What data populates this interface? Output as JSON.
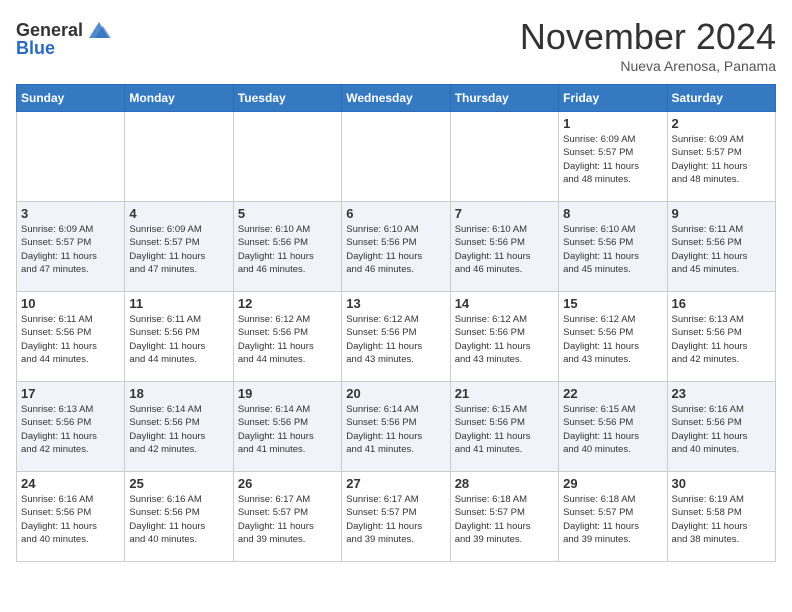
{
  "header": {
    "logo_general": "General",
    "logo_blue": "Blue",
    "month_title": "November 2024",
    "location": "Nueva Arenosa, Panama"
  },
  "weekdays": [
    "Sunday",
    "Monday",
    "Tuesday",
    "Wednesday",
    "Thursday",
    "Friday",
    "Saturday"
  ],
  "weeks": [
    [
      {
        "day": "",
        "info": ""
      },
      {
        "day": "",
        "info": ""
      },
      {
        "day": "",
        "info": ""
      },
      {
        "day": "",
        "info": ""
      },
      {
        "day": "",
        "info": ""
      },
      {
        "day": "1",
        "info": "Sunrise: 6:09 AM\nSunset: 5:57 PM\nDaylight: 11 hours\nand 48 minutes."
      },
      {
        "day": "2",
        "info": "Sunrise: 6:09 AM\nSunset: 5:57 PM\nDaylight: 11 hours\nand 48 minutes."
      }
    ],
    [
      {
        "day": "3",
        "info": "Sunrise: 6:09 AM\nSunset: 5:57 PM\nDaylight: 11 hours\nand 47 minutes."
      },
      {
        "day": "4",
        "info": "Sunrise: 6:09 AM\nSunset: 5:57 PM\nDaylight: 11 hours\nand 47 minutes."
      },
      {
        "day": "5",
        "info": "Sunrise: 6:10 AM\nSunset: 5:56 PM\nDaylight: 11 hours\nand 46 minutes."
      },
      {
        "day": "6",
        "info": "Sunrise: 6:10 AM\nSunset: 5:56 PM\nDaylight: 11 hours\nand 46 minutes."
      },
      {
        "day": "7",
        "info": "Sunrise: 6:10 AM\nSunset: 5:56 PM\nDaylight: 11 hours\nand 46 minutes."
      },
      {
        "day": "8",
        "info": "Sunrise: 6:10 AM\nSunset: 5:56 PM\nDaylight: 11 hours\nand 45 minutes."
      },
      {
        "day": "9",
        "info": "Sunrise: 6:11 AM\nSunset: 5:56 PM\nDaylight: 11 hours\nand 45 minutes."
      }
    ],
    [
      {
        "day": "10",
        "info": "Sunrise: 6:11 AM\nSunset: 5:56 PM\nDaylight: 11 hours\nand 44 minutes."
      },
      {
        "day": "11",
        "info": "Sunrise: 6:11 AM\nSunset: 5:56 PM\nDaylight: 11 hours\nand 44 minutes."
      },
      {
        "day": "12",
        "info": "Sunrise: 6:12 AM\nSunset: 5:56 PM\nDaylight: 11 hours\nand 44 minutes."
      },
      {
        "day": "13",
        "info": "Sunrise: 6:12 AM\nSunset: 5:56 PM\nDaylight: 11 hours\nand 43 minutes."
      },
      {
        "day": "14",
        "info": "Sunrise: 6:12 AM\nSunset: 5:56 PM\nDaylight: 11 hours\nand 43 minutes."
      },
      {
        "day": "15",
        "info": "Sunrise: 6:12 AM\nSunset: 5:56 PM\nDaylight: 11 hours\nand 43 minutes."
      },
      {
        "day": "16",
        "info": "Sunrise: 6:13 AM\nSunset: 5:56 PM\nDaylight: 11 hours\nand 42 minutes."
      }
    ],
    [
      {
        "day": "17",
        "info": "Sunrise: 6:13 AM\nSunset: 5:56 PM\nDaylight: 11 hours\nand 42 minutes."
      },
      {
        "day": "18",
        "info": "Sunrise: 6:14 AM\nSunset: 5:56 PM\nDaylight: 11 hours\nand 42 minutes."
      },
      {
        "day": "19",
        "info": "Sunrise: 6:14 AM\nSunset: 5:56 PM\nDaylight: 11 hours\nand 41 minutes."
      },
      {
        "day": "20",
        "info": "Sunrise: 6:14 AM\nSunset: 5:56 PM\nDaylight: 11 hours\nand 41 minutes."
      },
      {
        "day": "21",
        "info": "Sunrise: 6:15 AM\nSunset: 5:56 PM\nDaylight: 11 hours\nand 41 minutes."
      },
      {
        "day": "22",
        "info": "Sunrise: 6:15 AM\nSunset: 5:56 PM\nDaylight: 11 hours\nand 40 minutes."
      },
      {
        "day": "23",
        "info": "Sunrise: 6:16 AM\nSunset: 5:56 PM\nDaylight: 11 hours\nand 40 minutes."
      }
    ],
    [
      {
        "day": "24",
        "info": "Sunrise: 6:16 AM\nSunset: 5:56 PM\nDaylight: 11 hours\nand 40 minutes."
      },
      {
        "day": "25",
        "info": "Sunrise: 6:16 AM\nSunset: 5:56 PM\nDaylight: 11 hours\nand 40 minutes."
      },
      {
        "day": "26",
        "info": "Sunrise: 6:17 AM\nSunset: 5:57 PM\nDaylight: 11 hours\nand 39 minutes."
      },
      {
        "day": "27",
        "info": "Sunrise: 6:17 AM\nSunset: 5:57 PM\nDaylight: 11 hours\nand 39 minutes."
      },
      {
        "day": "28",
        "info": "Sunrise: 6:18 AM\nSunset: 5:57 PM\nDaylight: 11 hours\nand 39 minutes."
      },
      {
        "day": "29",
        "info": "Sunrise: 6:18 AM\nSunset: 5:57 PM\nDaylight: 11 hours\nand 39 minutes."
      },
      {
        "day": "30",
        "info": "Sunrise: 6:19 AM\nSunset: 5:58 PM\nDaylight: 11 hours\nand 38 minutes."
      }
    ]
  ]
}
